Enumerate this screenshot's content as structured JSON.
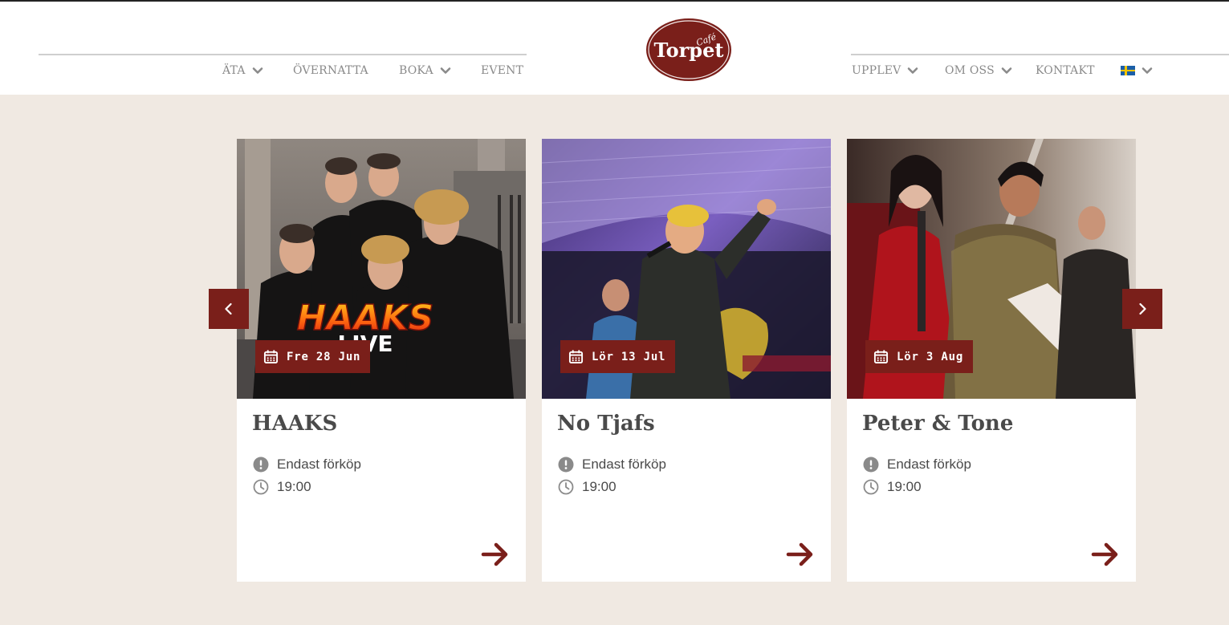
{
  "brand": {
    "logo_small": "Café",
    "logo_main": "Torpet",
    "color": "#7a1f1a"
  },
  "nav_left": [
    {
      "label": "ÄTA",
      "dropdown": true
    },
    {
      "label": "ÖVERNATTA",
      "dropdown": false
    },
    {
      "label": "BOKA",
      "dropdown": true
    },
    {
      "label": "EVENT",
      "dropdown": false
    }
  ],
  "nav_right": [
    {
      "label": "UPPLEV",
      "dropdown": true
    },
    {
      "label": "OM OSS",
      "dropdown": true
    },
    {
      "label": "KONTAKT",
      "dropdown": false
    }
  ],
  "language": {
    "icon": "sweden-flag-icon",
    "dropdown": true
  },
  "events": [
    {
      "date": "Fre 28 Jun",
      "title": "HAAKS",
      "image_text_1": "HAAKS",
      "image_text_2": "LIVE",
      "info": "Endast förköp",
      "time": "19:00"
    },
    {
      "date": "Lör 13 Jul",
      "title": "No Tjafs",
      "info": "Endast förköp",
      "time": "19:00"
    },
    {
      "date": "Lör 3 Aug",
      "title": "Peter & Tone",
      "info": "Endast förköp",
      "time": "19:00"
    }
  ],
  "icons": {
    "prev": "chevron-left-icon",
    "next": "chevron-right-icon",
    "calendar": "calendar-icon",
    "info": "exclamation-circle-icon",
    "clock": "clock-icon",
    "arrow": "arrow-right-icon"
  }
}
